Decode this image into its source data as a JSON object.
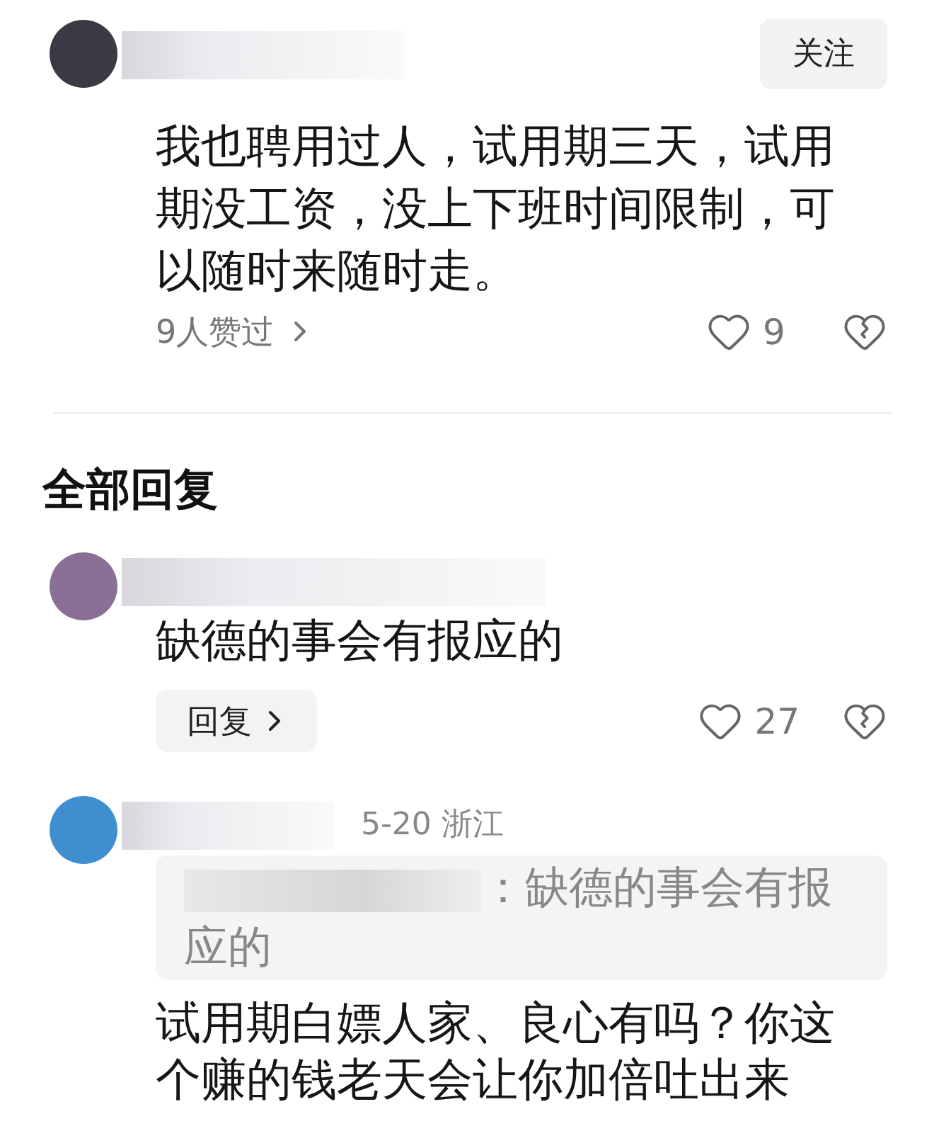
{
  "top_comment": {
    "follow_label": "关注",
    "text": "我也聘用过人，试用期三天，试用期没工资，没上下班时间限制，可以随时来随时走。",
    "liked_by": "9人赞过",
    "like_count": "9"
  },
  "replies_heading": "全部回复",
  "replies": [
    {
      "kind": "plain",
      "text": "缺德的事会有报应的",
      "reply_label": "回复",
      "like_count": "27"
    },
    {
      "kind": "quoted",
      "meta": "5-20 浙江",
      "quote": "：缺德的事会有报应的",
      "text": "试用期白嫖人家、良心有吗？你这个赚的钱老天会让你加倍吐出来"
    }
  ]
}
